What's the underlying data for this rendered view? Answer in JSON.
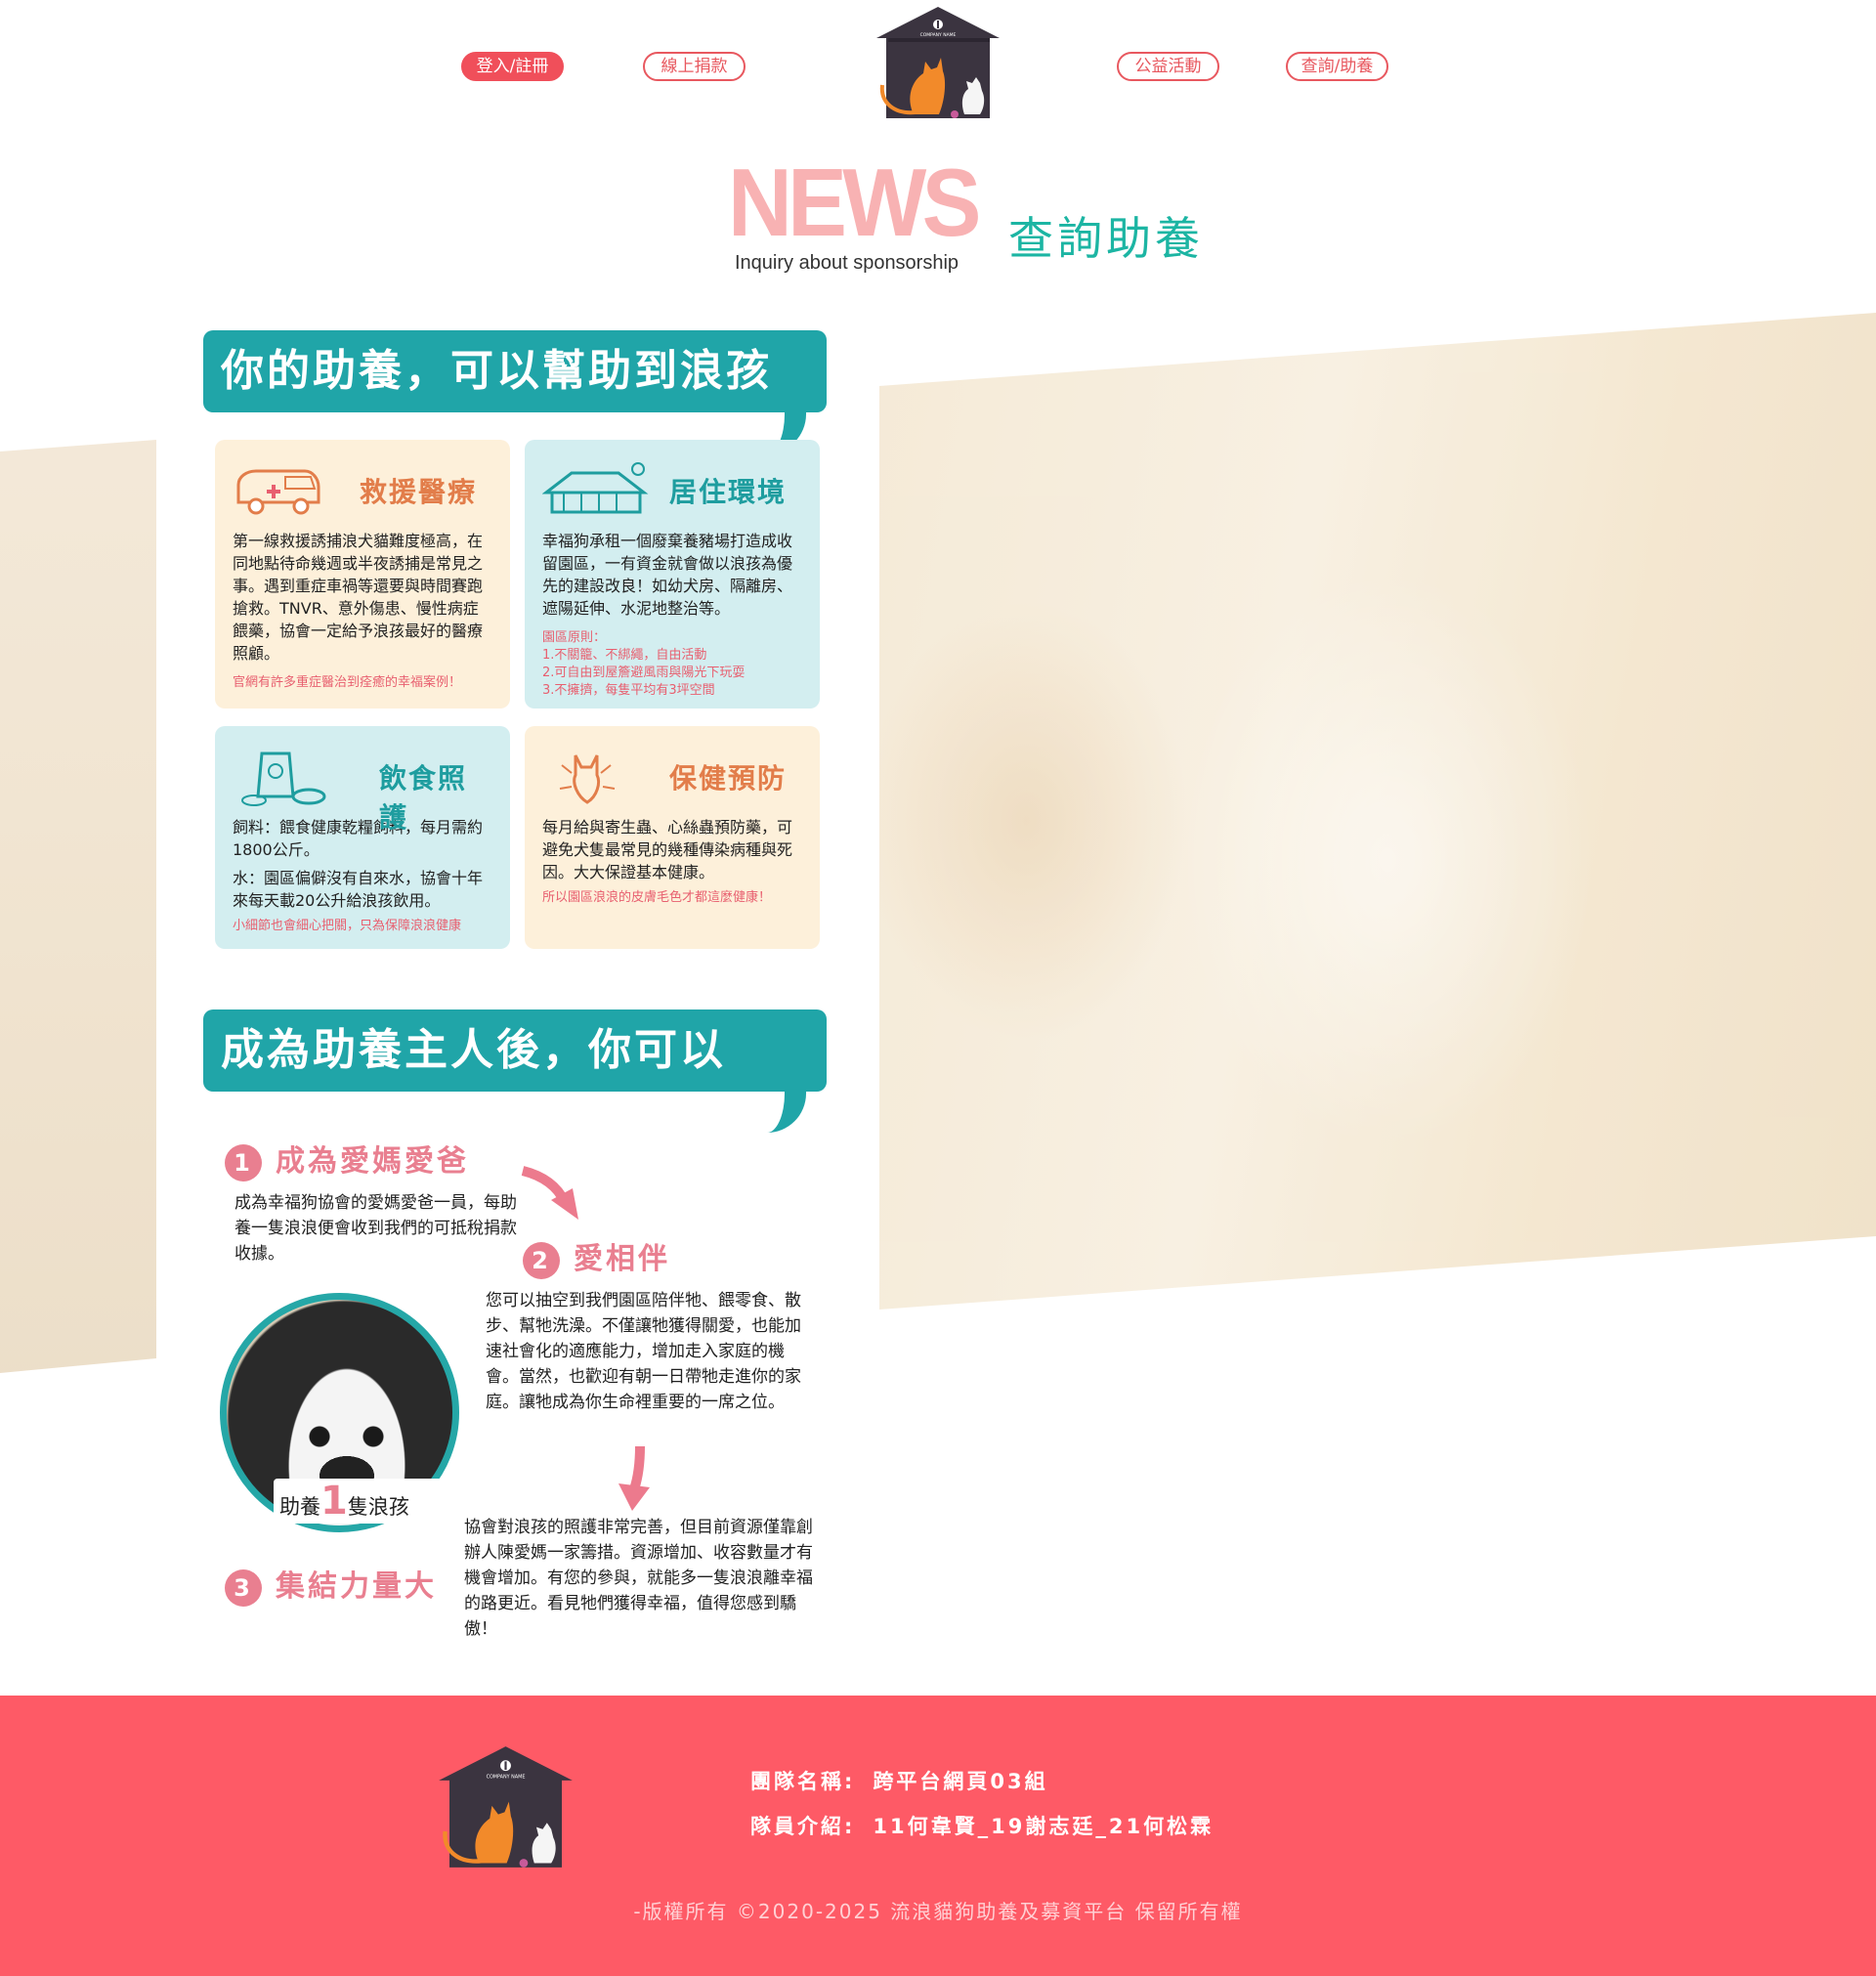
{
  "nav": {
    "login": "登入/註冊",
    "donate": "線上捐款",
    "events": "公益活動",
    "sponsor": "查詢/助養"
  },
  "logo": {
    "text": "COMPANY NAME"
  },
  "page_title": {
    "main": "NEWS",
    "subtitle": "Inquiry about sponsorship",
    "zh": "查詢助養"
  },
  "info_section_1": {
    "banner": "你的助養，可以幫助到浪孩",
    "cards": [
      {
        "title": "救援醫療",
        "body": "第一線救援誘捕浪犬貓難度極高，在同地點待命幾週或半夜誘捕是常見之事。遇到重症車禍等還要與時間賽跑搶救。TNVR、意外傷患、慢性病症餵藥，協會一定給予浪孩最好的醫療照顧。",
        "note": "官網有許多重症醫治到痊癒的幸福案例！"
      },
      {
        "title": "居住環境",
        "body": "幸福狗承租一個廢棄養豬場打造成收留園區，一有資金就會做以浪孩為優先的建設改良！如幼犬房、隔離房、遮陽延伸、水泥地整治等。",
        "rules_title": "園區原則：",
        "rules": [
          "1.不關籠、不綁繩，自由活動",
          "2.可自由到屋簷避風雨與陽光下玩耍",
          "3.不擁擠，每隻平均有3坪空間"
        ]
      },
      {
        "title": "飲食照護",
        "body": "飼料：餵食健康乾糧飼料，每月需約1800公斤。",
        "body2": "水：園區偏僻沒有自來水，協會十年來每天載20公升給浪孩飲用。",
        "note": "小細節也會細心把關，只為保障浪浪健康"
      },
      {
        "title": "保健預防",
        "body": "每月給與寄生蟲、心絲蟲預防藥，可避免犬隻最常見的幾種傳染病種與死因。大大保證基本健康。",
        "note": "所以園區浪浪的皮膚毛色才都這麼健康！"
      }
    ]
  },
  "info_section_2": {
    "banner": "成為助養主人後，你可以",
    "steps": [
      {
        "num": "1",
        "title": "成為愛媽愛爸",
        "text": "成為幸福狗協會的愛媽愛爸一員，每助養一隻浪浪便會收到我們的可抵稅捐款收據。"
      },
      {
        "num": "2",
        "title": "愛相伴",
        "text": "您可以抽空到我們園區陪伴牠、餵零食、散步、幫牠洗澡。不僅讓牠獲得關愛，也能加速社會化的適應能力，增加走入家庭的機會。當然，也歡迎有朝一日帶牠走進你的家庭。讓牠成為你生命裡重要的一席之位。"
      },
      {
        "num": "3",
        "title": "集結力量大",
        "text": "協會對浪孩的照護非常完善，但目前資源僅靠創辦人陳愛媽一家籌措。資源增加、收容數量才有機會增加。有您的參與，就能多一隻浪浪離幸福的路更近。看見牠們獲得幸福，值得您感到驕傲！"
      }
    ],
    "adopt_label": {
      "pre": "助養",
      "num": "1",
      "post": "隻浪孩"
    }
  },
  "footer": {
    "team_label": "團隊名稱:",
    "team_value": "跨平台網頁03組",
    "members_label": "隊員介紹:",
    "members_value": "11何韋賢_19謝志廷_21何松霖",
    "copyright": "-版權所有 ©2020-2025 流浪貓狗助養及募資平台 保留所有權"
  },
  "colors": {
    "nav_red": "#f04f5a",
    "footer_bg": "#fe5a66",
    "teal": "#20a5a8",
    "pink_title": "#f8b2b3",
    "zh_title": "#1cb5a3"
  }
}
